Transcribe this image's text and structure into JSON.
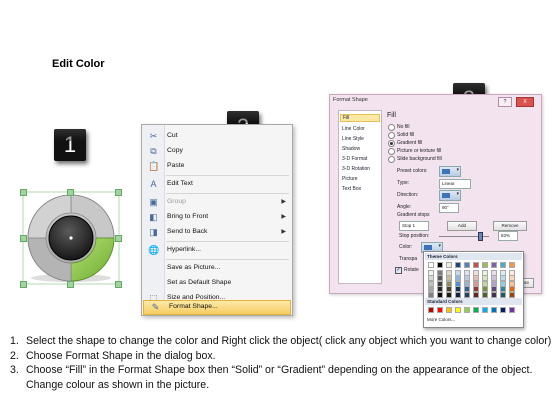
{
  "title": "Edit Color",
  "badges": [
    "1",
    "2",
    "3"
  ],
  "context_menu": {
    "items": [
      {
        "label": "Cut",
        "icon": "scissors-icon",
        "glyph": "✂"
      },
      {
        "label": "Copy",
        "icon": "copy-icon",
        "glyph": "⧉"
      },
      {
        "label": "Paste",
        "icon": "paste-icon",
        "glyph": "📋"
      },
      {
        "label": "Edit Text",
        "icon": "text-icon",
        "glyph": "A"
      },
      {
        "label": "Group",
        "icon": "group-icon",
        "glyph": "▣"
      },
      {
        "label": "Bring to Front",
        "icon": "bring-front-icon",
        "glyph": "◧"
      },
      {
        "label": "Send to Back",
        "icon": "send-back-icon",
        "glyph": "◨"
      },
      {
        "label": "Hyperlink...",
        "icon": "hyperlink-icon",
        "glyph": "🌐"
      },
      {
        "label": "Save as Picture...",
        "icon": "",
        "glyph": ""
      },
      {
        "label": "Set as Default Shape",
        "icon": "",
        "glyph": ""
      },
      {
        "label": "Size and Position...",
        "icon": "size-icon",
        "glyph": "⬚"
      },
      {
        "label": "Format Shape...",
        "icon": "format-shape-icon",
        "glyph": "✎"
      }
    ]
  },
  "dialog": {
    "title": "Format Shape",
    "nav": [
      "Fill",
      "Line Color",
      "Line Style",
      "Shadow",
      "3-D Format",
      "3-D Rotation",
      "Picture",
      "Text Box"
    ],
    "section": "Fill",
    "fill_options": [
      "No fill",
      "Solid fill",
      "Gradient fill",
      "Picture or texture fill",
      "Slide background fill"
    ],
    "preset_colors": "Preset colors:",
    "type_label": "Type:",
    "type_value": "Linear",
    "direction_label": "Direction:",
    "angle_label": "Angle:",
    "angle_value": "90°",
    "gradient_stops": "Gradient stops",
    "stop_value": "Stop 1",
    "add_label": "Add",
    "remove_label": "Remove",
    "stop_position_label": "Stop position:",
    "stop_position_value": "83%",
    "color_label": "Color:",
    "transparency_label": "Transpa",
    "rotate_label": "Rotate",
    "close_label": "Close",
    "help": "?",
    "close_x": "X"
  },
  "color_popup": {
    "theme_colors": "Theme Colors",
    "standard_colors": "Standard Colors",
    "more_colors": "More Colors...",
    "theme_top": [
      "#ffffff",
      "#000000",
      "#eeece1",
      "#1f497d",
      "#4f81bd",
      "#c0504d",
      "#9bbb59",
      "#8064a2",
      "#4bacc6",
      "#f79646"
    ],
    "theme_shades": [
      [
        "#f2f2f2",
        "#7f7f7f",
        "#ddd9c3",
        "#c6d9f0",
        "#dbe5f1",
        "#f2dcdb",
        "#ebf1dd",
        "#e5e0ec",
        "#dbeef3",
        "#fdeada"
      ],
      [
        "#d8d8d8",
        "#595959",
        "#c4bd97",
        "#8db3e2",
        "#b8cce4",
        "#e5b9b7",
        "#d7e3bc",
        "#ccc1d9",
        "#b7dde8",
        "#fbd5b5"
      ],
      [
        "#bfbfbf",
        "#3f3f3f",
        "#938953",
        "#548dd4",
        "#95b3d7",
        "#d99694",
        "#c3d69b",
        "#b2a2c7",
        "#92cddc",
        "#fac08f"
      ],
      [
        "#a5a5a5",
        "#262626",
        "#494429",
        "#17365d",
        "#366092",
        "#953734",
        "#76923c",
        "#5f497a",
        "#31859b",
        "#e36c09"
      ],
      [
        "#7f7f7f",
        "#0c0c0c",
        "#1d1b10",
        "#0f243e",
        "#244061",
        "#632423",
        "#4f6128",
        "#3f3151",
        "#205867",
        "#974806"
      ]
    ],
    "standard": [
      "#c00000",
      "#ff0000",
      "#ffc000",
      "#ffff00",
      "#92d050",
      "#00b050",
      "#00b0f0",
      "#0070c0",
      "#002060",
      "#7030a0"
    ]
  },
  "instructions": [
    {
      "num": "1.",
      "text": "Select the shape to change the color and Right click the object( click any object which you want to change color)"
    },
    {
      "num": "2.",
      "text": "Choose Format Shape in the dialog box."
    },
    {
      "num": "3.",
      "text": "Choose “Fill” in the Format Shape box then “Solid” or “Gradient” depending on the appearance of the object. Change colour as shown in the picture."
    }
  ],
  "colors": {
    "accent_green": "#8cc63f",
    "ring_gray": "#9a9a9a",
    "center_dark": "#1c1c1c",
    "highlight": "#f7cd62"
  }
}
